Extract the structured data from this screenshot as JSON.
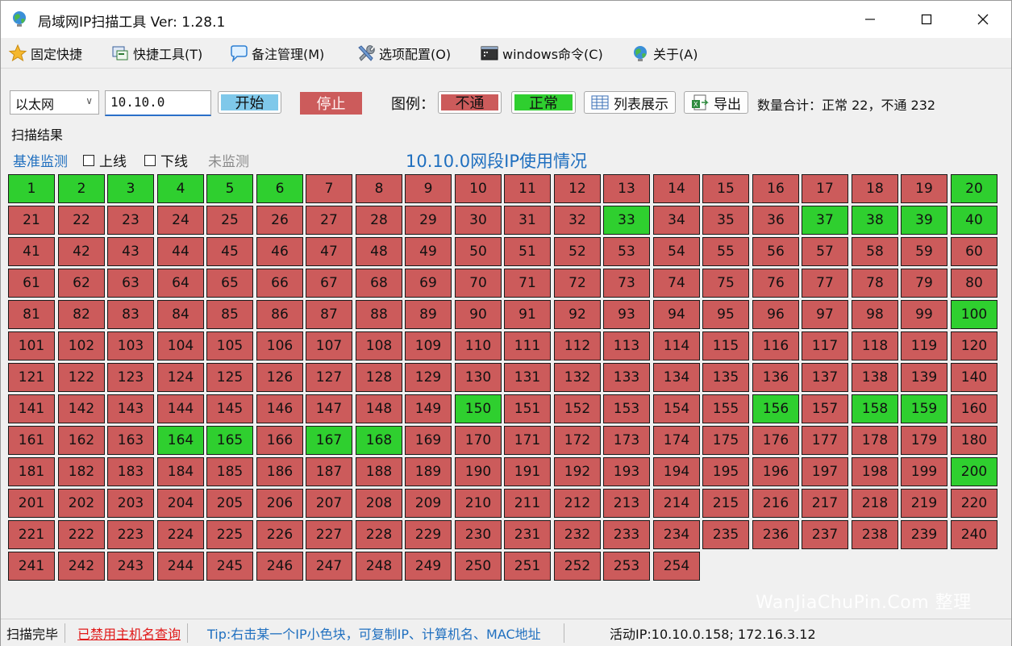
{
  "window": {
    "title": "局域网IP扫描工具  Ver: 1.28.1"
  },
  "menu": {
    "items": [
      {
        "label": "固定快捷",
        "icon": "star-icon"
      },
      {
        "label": "快捷工具(T)",
        "icon": "tools-window-icon"
      },
      {
        "label": "备注管理(M)",
        "icon": "speech-bubble-icon"
      },
      {
        "label": "选项配置(O)",
        "icon": "wrench-icon"
      },
      {
        "label": "windows命令(C)",
        "icon": "terminal-icon"
      },
      {
        "label": "关于(A)",
        "icon": "globe-icon"
      }
    ]
  },
  "toolbar": {
    "adapter": "以太网",
    "ip_prefix": "10.10.0",
    "start_label": "开始",
    "stop_label": "停止",
    "legend_label": "图例：",
    "legend_down": "不通",
    "legend_up": "正常",
    "list_view_label": "列表展示",
    "export_label": "导出",
    "count_text": "数量合计：正常 22，不通 232"
  },
  "results": {
    "group_label": "扫描结果",
    "base_monitor": "基准监测",
    "online_label": "上线",
    "offline_label": "下线",
    "unmonitored_label": "未监测",
    "subnet_title": "10.10.0网段IP使用情况",
    "total_hosts": 254,
    "up_hosts": [
      1,
      2,
      3,
      4,
      5,
      6,
      20,
      33,
      37,
      38,
      39,
      40,
      100,
      150,
      156,
      158,
      159,
      164,
      165,
      167,
      168,
      200
    ]
  },
  "colors": {
    "up": "#2fcf2f",
    "down": "#cc5b5b",
    "start_button": "#7fc8ea",
    "accent_text": "#1f6fbf"
  },
  "statusbar": {
    "status": "扫描完毕",
    "hostname_lookup": "已禁用主机名查询",
    "tip": "Tip:右击某一个IP小色块，可复制IP、计算机名、MAC地址",
    "active_ip": "活动IP:10.10.0.158; 172.16.3.12"
  },
  "watermark": "WanJiaChuPin.Com 整理"
}
